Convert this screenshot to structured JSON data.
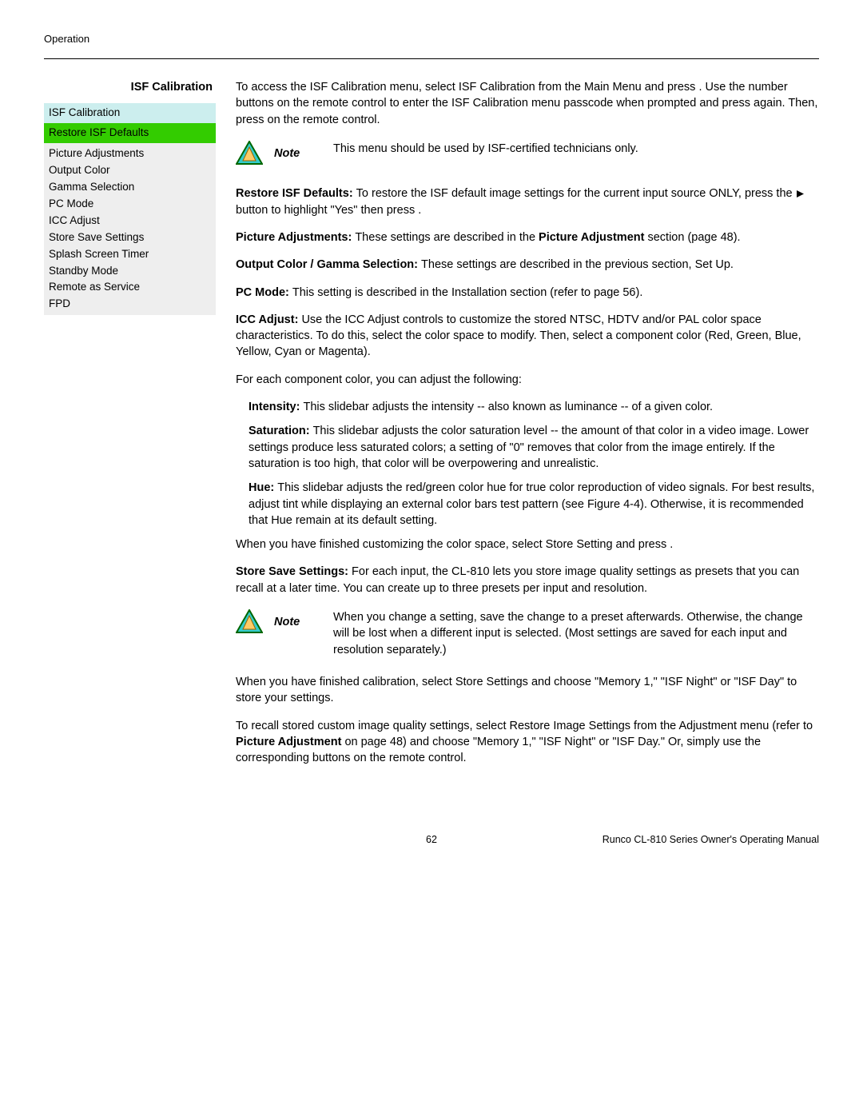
{
  "header": {
    "section": "Operation"
  },
  "sidebar": {
    "title": "ISF Calibration",
    "menu_header": "ISF Calibration",
    "menu_active": "Restore ISF Defaults",
    "items": [
      "Picture Adjustments",
      "Output Color",
      "Gamma Selection",
      "PC Mode",
      "ICC Adjust",
      "Store Save Settings",
      "Splash Screen Timer",
      "Standby Mode",
      "Remote as Service",
      "FPD"
    ]
  },
  "intro": {
    "p1a": "To access the ISF Calibration menu, select ISF Calibration from the Main Menu and press ",
    "p1b": ". Use the number buttons on the remote control to enter the ISF Calibration menu passcode when prompted and press ",
    "p1c": " again. Then, press ",
    "p1d": " on the remote control."
  },
  "note1": {
    "label": "Note",
    "text": "This menu should be used by ISF-certified technicians only."
  },
  "restore": {
    "label_a": "Restore ISF Defaults: ",
    "text_a": "To restore the ISF default image settings for the current input source ONLY, press the ",
    "text_b": " button to highlight \"Yes\" then press "
  },
  "picture_adj": {
    "label": "Picture Adjustments: ",
    "text_a": "These settings are described in the ",
    "bold": "Picture Adjustment",
    "text_b": " section (page 48)."
  },
  "output": {
    "label": "Output Color / Gamma Selection: ",
    "text": "These settings are described in the previous section, Set Up."
  },
  "pcmode": {
    "label": "PC Mode: ",
    "text": "This setting is described in the Installation section (refer to page 56)."
  },
  "icc": {
    "label": "ICC Adjust: ",
    "text": "Use the ICC Adjust controls to customize the stored NTSC, HDTV and/or PAL color space characteristics. To do this, select the color space to modify. Then, select a component color (Red, Green, Blue, Yellow, Cyan or Magenta)."
  },
  "each_comp": "For each component color, you can adjust the following:",
  "intensity": {
    "label": "Intensity: ",
    "text": "This slidebar adjusts the intensity -- also known as luminance -- of a given color."
  },
  "saturation": {
    "label": "Saturation: ",
    "text": "This slidebar adjusts the color saturation level -- the amount of that color in a video image. Lower settings produce less saturated colors; a setting of \"0\" removes that color from the image entirely. If the saturation is too high, that color will be overpowering and unrealistic."
  },
  "hue": {
    "label": "Hue: ",
    "text": "This slidebar adjusts the red/green color hue for true color reproduction of video signals. For best results, adjust tint while displaying an external color bars test pattern (see Figure 4-4). Otherwise, it is recommended that Hue remain at its default setting."
  },
  "finished_color": "When you have finished customizing the color space, select Store Setting and press ",
  "store_save": {
    "label": "Store Save Settings: ",
    "text": "For each input, the CL-810 lets you store image quality settings as presets that you can recall at a later time. You can create up to three presets per input and resolution."
  },
  "note2": {
    "label": "Note",
    "text": "When you change a setting, save the change to a preset afterwards. Otherwise, the change will be lost when a different input is selected. (Most settings are saved for each input and resolution separately.)"
  },
  "finished_cal": "When you have finished calibration, select Store Settings and choose \"Memory 1,\" \"ISF Night\" or \"ISF Day\" to store your settings.",
  "recall": {
    "a": "To recall stored custom image quality settings, select Restore Image Settings from the Adjustment menu (refer to ",
    "b": "Picture Adjustment",
    "c": " on page 48) and choose \"Memory 1,\" \"ISF Night\" or \"ISF Day.\" Or, simply use the corresponding buttons on the remote control."
  },
  "footer": {
    "page": "62",
    "manual": "Runco CL-810 Series Owner's Operating Manual"
  }
}
